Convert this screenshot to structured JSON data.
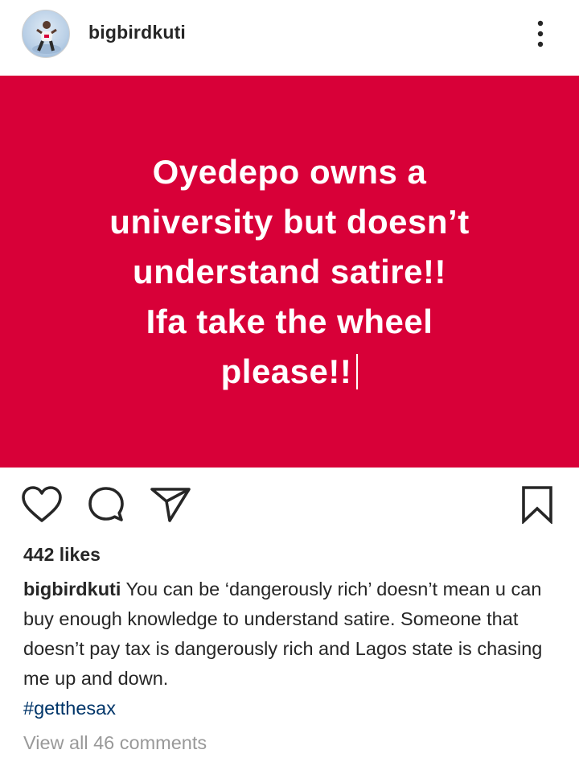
{
  "header": {
    "username": "bigbirdkuti"
  },
  "post": {
    "lines": [
      "Oyedepo owns a",
      "university but doesn’t",
      "understand satire!!",
      "Ifa take the wheel",
      "please!!"
    ],
    "background_color": "#d80038"
  },
  "actions": {
    "like_icon": "heart-icon",
    "comment_icon": "comment-icon",
    "share_icon": "send-icon",
    "save_icon": "bookmark-icon"
  },
  "likes_text": "442 likes",
  "caption": {
    "username": "bigbirdkuti",
    "text": " You can be ‘dangerously rich’ doesn’t mean u can buy enough knowledge to understand satire. Someone that doesn’t pay tax is dangerously rich and Lagos state is chasing me up and down.",
    "hashtag": "#getthesax"
  },
  "view_comments": "View all 46 comments"
}
